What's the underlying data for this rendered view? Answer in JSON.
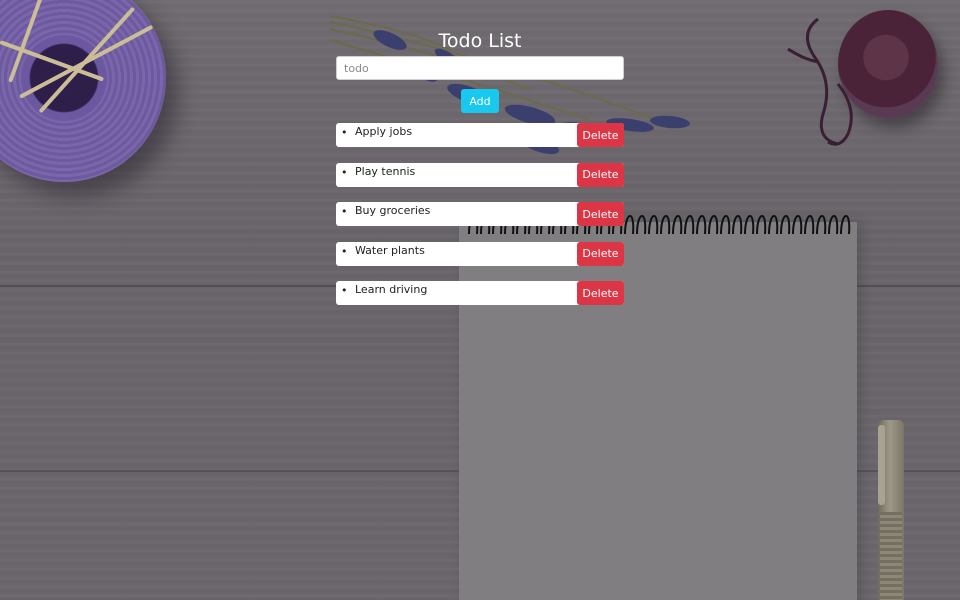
{
  "app": {
    "title": "Todo List",
    "input": {
      "placeholder": "todo",
      "value": ""
    },
    "add_label": "Add",
    "delete_label": "Delete",
    "todos": [
      "Apply jobs",
      "Play tennis",
      "Buy groceries",
      "Water plants",
      "Learn driving"
    ]
  },
  "colors": {
    "add_button": "#19c8ef",
    "delete_button": "#dc3545",
    "title": "#ffffff"
  }
}
